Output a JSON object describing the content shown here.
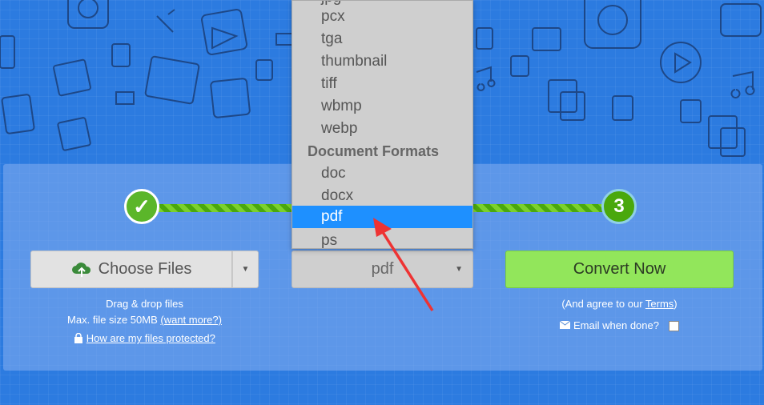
{
  "steps": {
    "step1_mark": "✓",
    "step3_number": "3"
  },
  "choose": {
    "label": "Choose Files",
    "caret": "▼"
  },
  "format": {
    "selected": "pdf",
    "caret": "▼"
  },
  "convert": {
    "label": "Convert Now"
  },
  "help": {
    "drag": "Drag & drop files",
    "maxsize": "Max. file size 50MB",
    "want_more": "(want more?)",
    "protected": "How are my files protected?"
  },
  "terms": {
    "prefix": "(And agree to our ",
    "link": "Terms",
    "suffix": ")"
  },
  "email": {
    "label": "Email when done?"
  },
  "dropdown": {
    "partial_top": "jpg",
    "items": [
      {
        "label": "pcx"
      },
      {
        "label": "tga"
      },
      {
        "label": "thumbnail"
      },
      {
        "label": "tiff"
      },
      {
        "label": "wbmp"
      },
      {
        "label": "webp"
      }
    ],
    "group": "Document Formats",
    "doc_items": [
      {
        "label": "doc"
      },
      {
        "label": "docx"
      },
      {
        "label": "pdf"
      },
      {
        "label": "ps"
      }
    ]
  },
  "colors": {
    "background": "#2c7be0",
    "selected": "#1e90ff",
    "convert": "#92e65b",
    "progress": "#7bd12c"
  },
  "icons": [
    "upload-cloud-icon",
    "lock-icon",
    "envelope-icon",
    "chevron-down-icon"
  ]
}
